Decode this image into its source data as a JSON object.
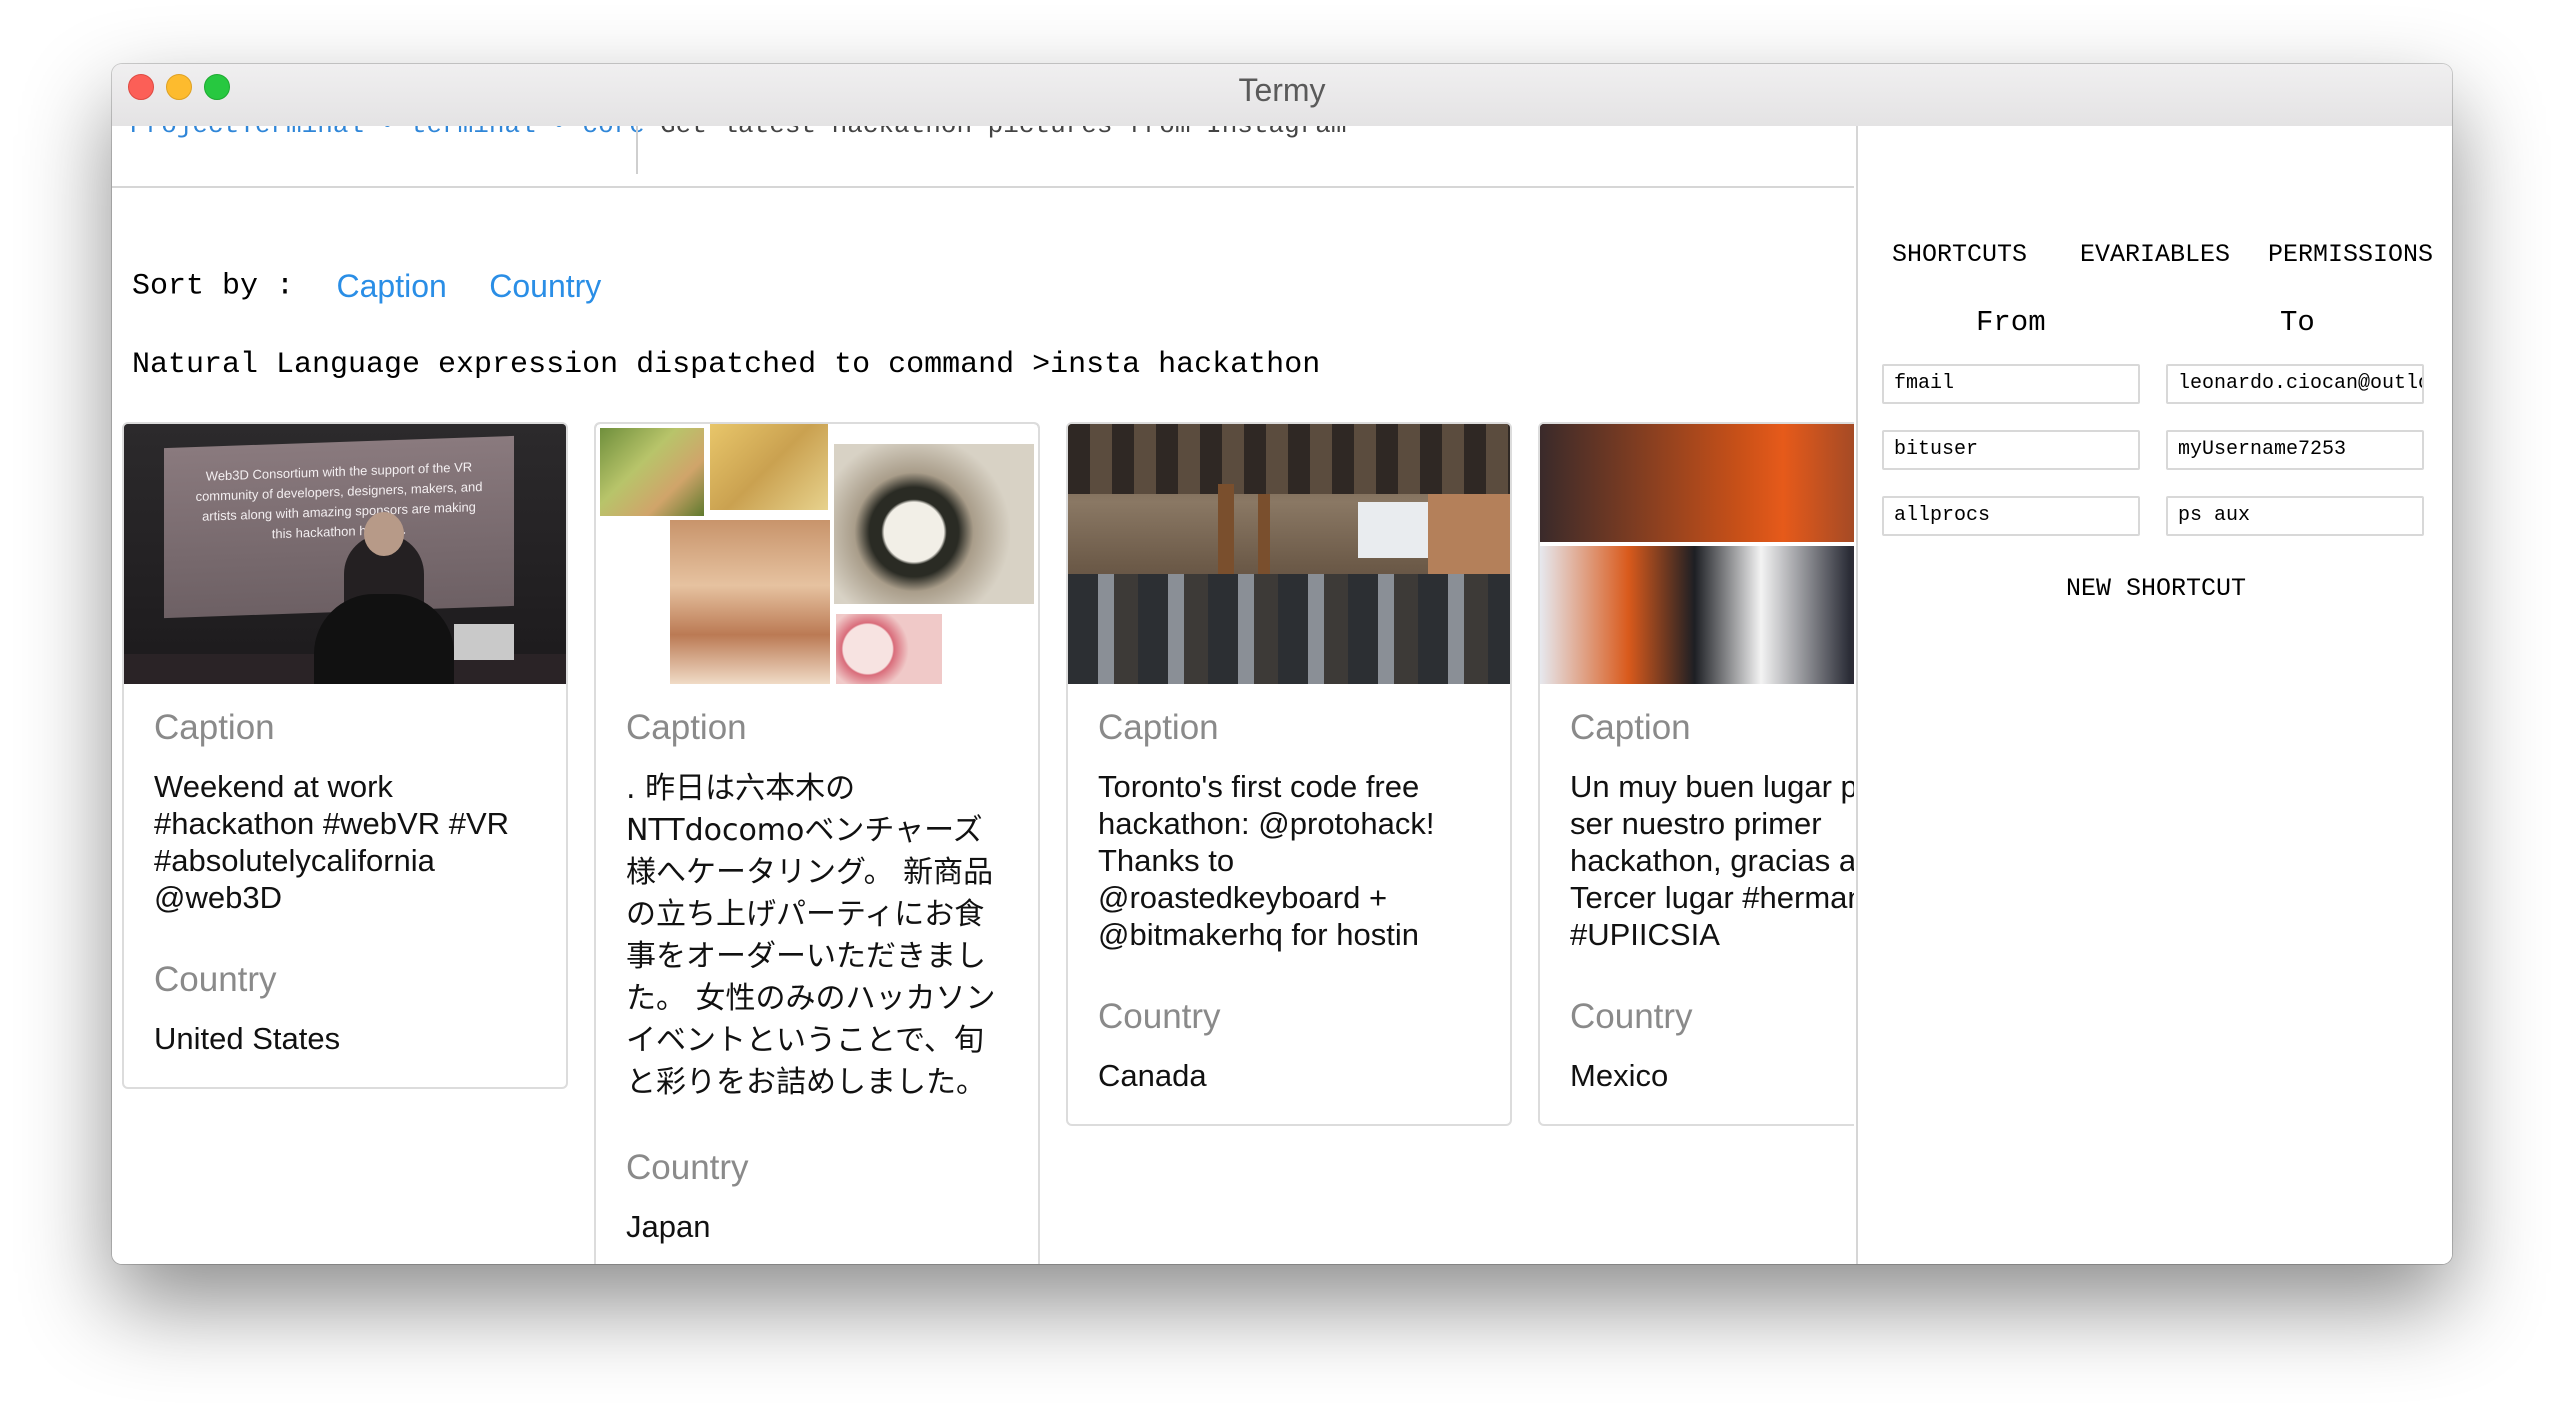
{
  "window": {
    "title": "Termy"
  },
  "header": {
    "breadcrumb": "ProjectTerminal • terminal • core",
    "command_text": "Get latest hackathon pictures from Instagram"
  },
  "sort": {
    "label": "Sort by :",
    "options": [
      "Caption",
      "Country"
    ]
  },
  "status": {
    "message": "Natural Language expression dispatched to command >insta hackathon"
  },
  "cards": [
    {
      "caption_label": "Caption",
      "caption": "Weekend at work\n#hackathon #webVR #VR\n#absolutelycalifornia\n@web3D",
      "country_label": "Country",
      "country": "United States",
      "image_text": "Web3D Consortium with the support of the VR community of developers, designers, makers, and artists along with amazing sponsors are making this hackathon happen."
    },
    {
      "caption_label": "Caption",
      "caption": ". 昨日は六本木の\nNTTdocomoベンチャーズ\n様へケータリング。 新商品\nの立ち上げパーティにお食\n事をオーダーいただきまし\nた。 女性のみのハッカソン\nイベントということで、旬\nと彩りをお詰めしました。",
      "country_label": "Country",
      "country": "Japan"
    },
    {
      "caption_label": "Caption",
      "caption": "Toronto's first code free\nhackathon: @protohack!\nThanks to\n@roastedkeyboard +\n@bitmakerhq for hostin",
      "country_label": "Country",
      "country": "Canada"
    },
    {
      "caption_label": "Caption",
      "caption": "Un muy buen lugar pa\nser nuestro primer\nhackathon, gracias am\nTercer lugar #hermanc\n#UPIICSIA",
      "country_label": "Country",
      "country": "Mexico"
    }
  ],
  "sidebar": {
    "tabs": [
      "SHORTCUTS",
      "EVARIABLES",
      "PERMISSIONS"
    ],
    "from_label": "From",
    "to_label": "To",
    "shortcuts": [
      {
        "from": "fmail",
        "to": "leonardo.ciocan@outlook"
      },
      {
        "from": "bituser",
        "to": "myUsername7253"
      },
      {
        "from": "allprocs",
        "to": "ps aux"
      }
    ],
    "new_shortcut_label": "NEW SHORTCUT"
  },
  "colors": {
    "link": "#2a8ee6",
    "breadcrumb": "#2f86d8",
    "close": "#fc5f57",
    "minimize": "#fdbb2e",
    "maximize": "#27c840"
  }
}
